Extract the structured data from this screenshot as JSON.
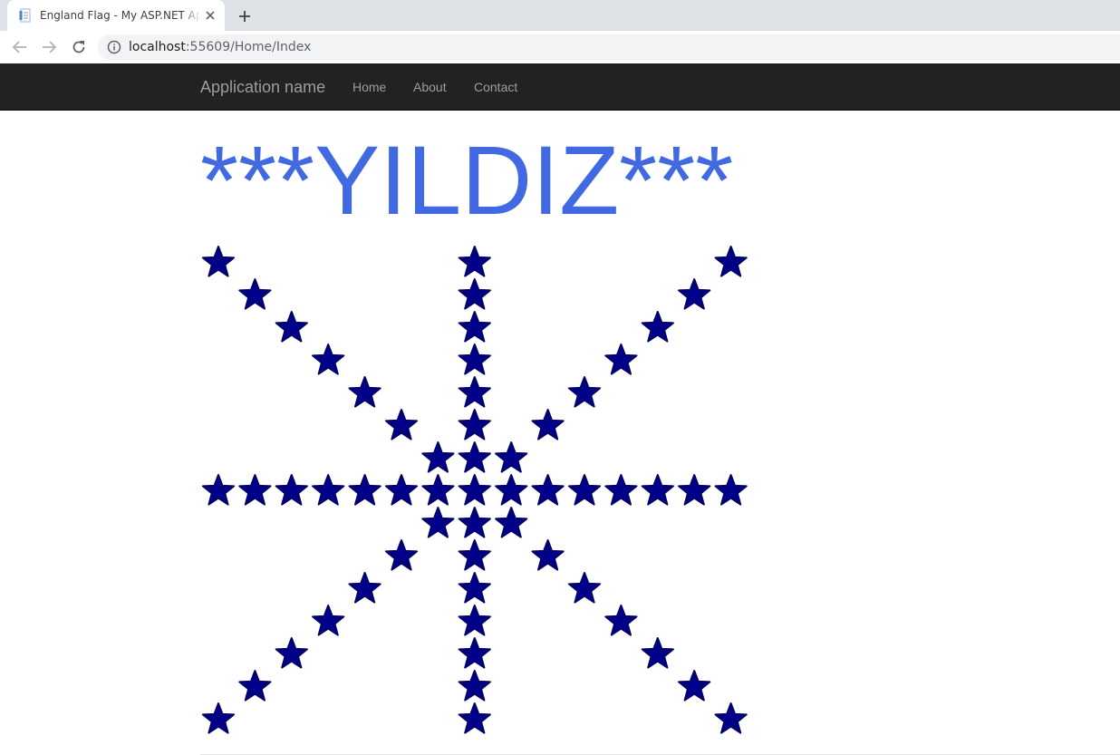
{
  "browser": {
    "tab_title": "England Flag - My ASP.NET Application",
    "url_host": "localhost",
    "url_path": ":55609/Home/Index",
    "icons": {
      "favicon": "document-icon",
      "close": "close-icon",
      "new_tab": "plus-icon",
      "back": "back-arrow-icon",
      "forward": "forward-arrow-icon",
      "reload": "reload-icon",
      "info": "info-icon"
    }
  },
  "navbar": {
    "brand": "Application name",
    "links": [
      "Home",
      "About",
      "Contact"
    ]
  },
  "page": {
    "heading": "***YILDIZ***"
  },
  "star_pattern": {
    "shape": "star",
    "color": "#00008b",
    "heading_color": "#4169e1",
    "grid_size": 15,
    "center_index": 7,
    "rays": [
      "horizontal",
      "vertical",
      "diagonal",
      "anti-diagonal"
    ],
    "inner_ring": "3x3 block around center"
  }
}
